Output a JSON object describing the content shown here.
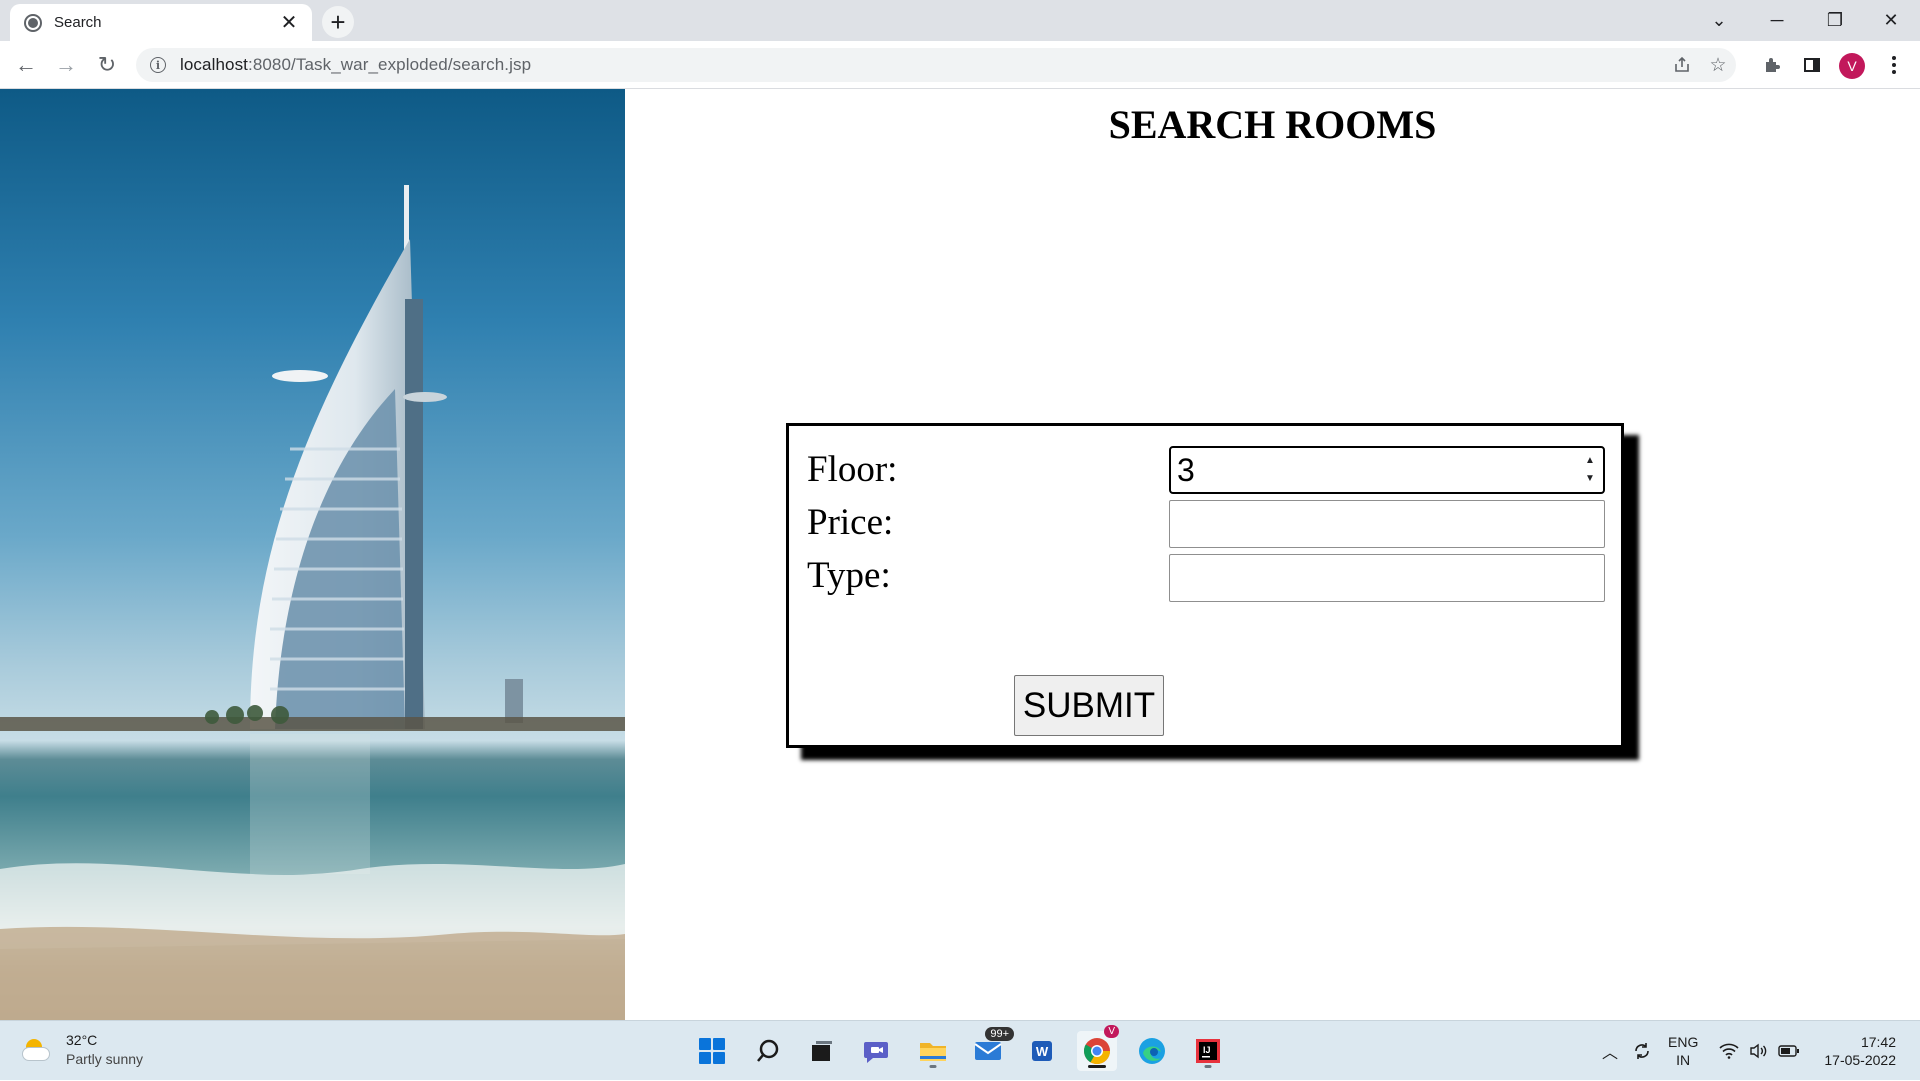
{
  "browser": {
    "tab_title": "Search",
    "tab_close": "✕",
    "new_tab": "+",
    "url_host": "localhost",
    "url_path": ":8080/Task_war_exploded/search.jsp",
    "profile_initial": "V",
    "window_controls": {
      "tabsearch": "⌄",
      "minimize": "─",
      "restore": "❐",
      "close": "✕"
    },
    "nav": {
      "back": "←",
      "forward": "→",
      "reload": "↻"
    },
    "icons": [
      "share-icon",
      "star-icon",
      "extensions-icon",
      "side-panel-icon",
      "kebab-menu-icon"
    ]
  },
  "page": {
    "title": "SEARCH ROOMS",
    "form": {
      "floor_label": "Floor:",
      "floor_value": "3",
      "price_label": "Price:",
      "price_value": "",
      "type_label": "Type:",
      "type_value": "",
      "submit_label": "SUBMIT"
    }
  },
  "taskbar": {
    "weather_temp": "32°C",
    "weather_condition": "Partly sunny",
    "mail_badge": "99+",
    "chrome_badge": "V",
    "lang_primary": "ENG",
    "lang_secondary": "IN",
    "time": "17:42",
    "date": "17-05-2022",
    "apps": [
      "start",
      "search",
      "task-view",
      "teams-chat",
      "file-explorer",
      "mail",
      "word",
      "chrome",
      "edge",
      "intellij"
    ]
  },
  "colors": {
    "accent_profile": "#c2185b",
    "tab_bar": "#dee1e6",
    "taskbar": "#dce8f0"
  }
}
